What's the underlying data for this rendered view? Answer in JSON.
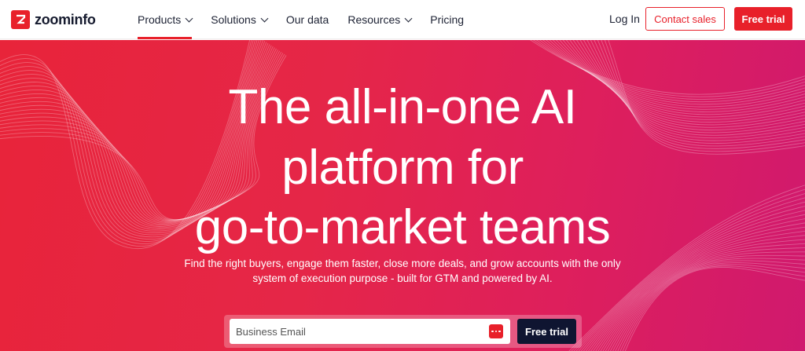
{
  "brand": {
    "name": "zoominfo",
    "accent": "#e8202a",
    "dark": "#0f1531"
  },
  "nav": {
    "items": [
      {
        "label": "Products",
        "has_dropdown": true,
        "active": true
      },
      {
        "label": "Solutions",
        "has_dropdown": true,
        "active": false
      },
      {
        "label": "Our data",
        "has_dropdown": false,
        "active": false
      },
      {
        "label": "Resources",
        "has_dropdown": true,
        "active": false
      },
      {
        "label": "Pricing",
        "has_dropdown": false,
        "active": false
      }
    ],
    "login": "Log In",
    "contact": "Contact sales",
    "trial": "Free trial"
  },
  "hero": {
    "headline": [
      "The all-in-one AI",
      "platform for",
      "go-to-market teams"
    ],
    "subtext": [
      "Find the right buyers, engage them faster, close more deals, and grow accounts with the only",
      "system of execution purpose - built for GTM and powered by AI."
    ],
    "email_placeholder": "Business Email",
    "cta": "Free trial",
    "field_icon": "password-manager-icon"
  }
}
